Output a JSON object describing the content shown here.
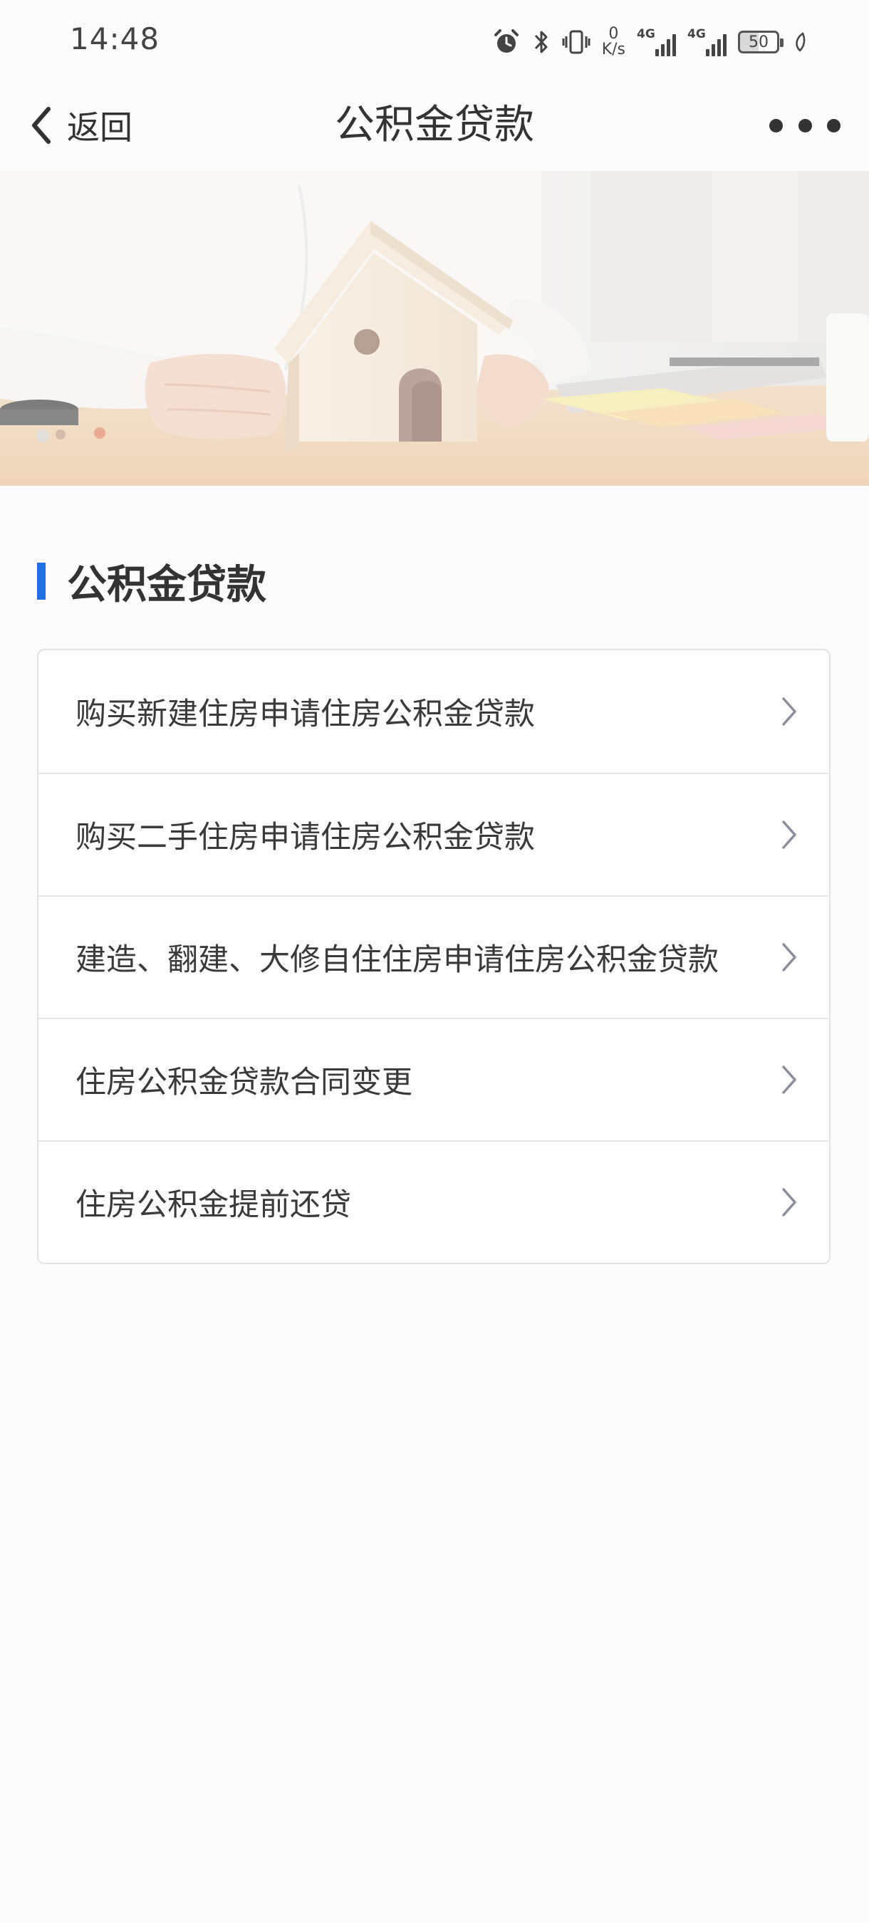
{
  "status_bar": {
    "time": "14:48",
    "net_speed_value": "0",
    "net_speed_unit": "K/s",
    "signal_1_generation": "4G",
    "signal_2_generation": "4G",
    "battery_level": "50",
    "icons": [
      "alarm-icon",
      "bluetooth-icon",
      "vibrate-icon",
      "network-speed",
      "signal-icon",
      "signal-icon",
      "battery-icon",
      "leaf-icon"
    ]
  },
  "nav": {
    "back_label": "返回",
    "title": "公积金贷款",
    "more_icon": "more-horizontal-icon"
  },
  "banner": {
    "image": "hands holding a small wooden toy house on a desk"
  },
  "section": {
    "title": "公积金贷款",
    "accent_color": "#1f6fe5"
  },
  "items": [
    {
      "label": "购买新建住房申请住房公积金贷款"
    },
    {
      "label": "购买二手住房申请住房公积金贷款"
    },
    {
      "label": "建造、翻建、大修自住住房申请住房公积金贷款"
    },
    {
      "label": "住房公积金贷款合同变更"
    },
    {
      "label": "住房公积金提前还贷"
    }
  ]
}
